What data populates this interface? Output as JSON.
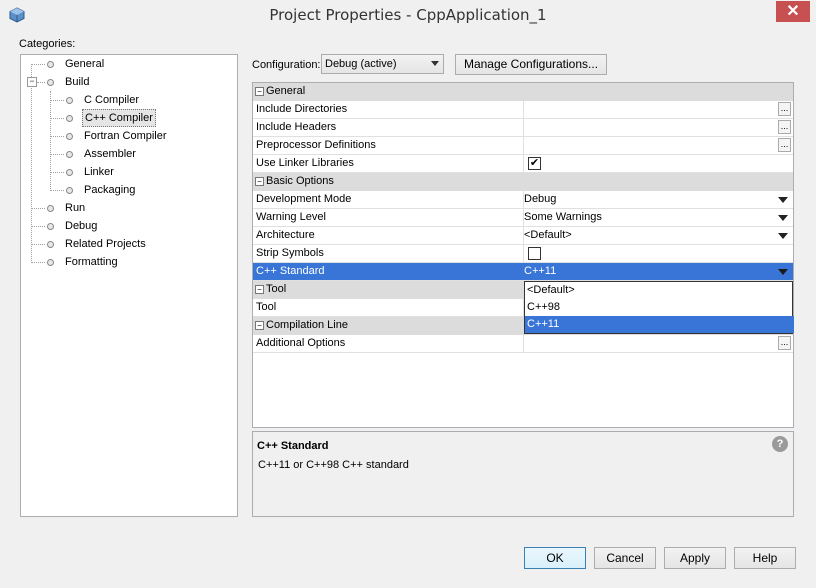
{
  "window": {
    "title": "Project Properties - CppApplication_1",
    "close_glyph": "✕"
  },
  "categories": {
    "label": "Categories:",
    "items": [
      {
        "label": "General"
      },
      {
        "label": "Build"
      },
      {
        "label": "C Compiler"
      },
      {
        "label": "C++ Compiler"
      },
      {
        "label": "Fortran Compiler"
      },
      {
        "label": "Assembler"
      },
      {
        "label": "Linker"
      },
      {
        "label": "Packaging"
      },
      {
        "label": "Run"
      },
      {
        "label": "Debug"
      },
      {
        "label": "Related Projects"
      },
      {
        "label": "Formatting"
      }
    ]
  },
  "configuration": {
    "label": "Configuration:",
    "value": "Debug (active)",
    "manage_label": "Manage Configurations..."
  },
  "sheet": {
    "general": "General",
    "include_dirs": "Include Directories",
    "include_headers": "Include Headers",
    "preprocessor": "Preprocessor Definitions",
    "use_linker_libs": "Use Linker Libraries",
    "basic_options": "Basic Options",
    "dev_mode": "Development Mode",
    "dev_mode_val": "Debug",
    "warning_level": "Warning Level",
    "warning_level_val": "Some Warnings",
    "architecture": "Architecture",
    "architecture_val": "<Default>",
    "strip_symbols": "Strip Symbols",
    "cpp_standard": "C++ Standard",
    "cpp_standard_val": "C++11",
    "tool_cat": "Tool",
    "tool": "Tool",
    "compilation_line": "Compilation Line",
    "additional_options": "Additional Options",
    "ellipsis": "...",
    "check_mark": "✔"
  },
  "dropdown": {
    "options": [
      "<Default>",
      "C++98",
      "C++11"
    ],
    "selected": "C++11"
  },
  "description": {
    "title": "C++ Standard",
    "text": "C++11 or C++98 C++ standard",
    "help_glyph": "?"
  },
  "buttons": {
    "ok": "OK",
    "cancel": "Cancel",
    "apply": "Apply",
    "help": "Help"
  },
  "colors": {
    "selection": "#3875d7",
    "close": "#c75050"
  }
}
